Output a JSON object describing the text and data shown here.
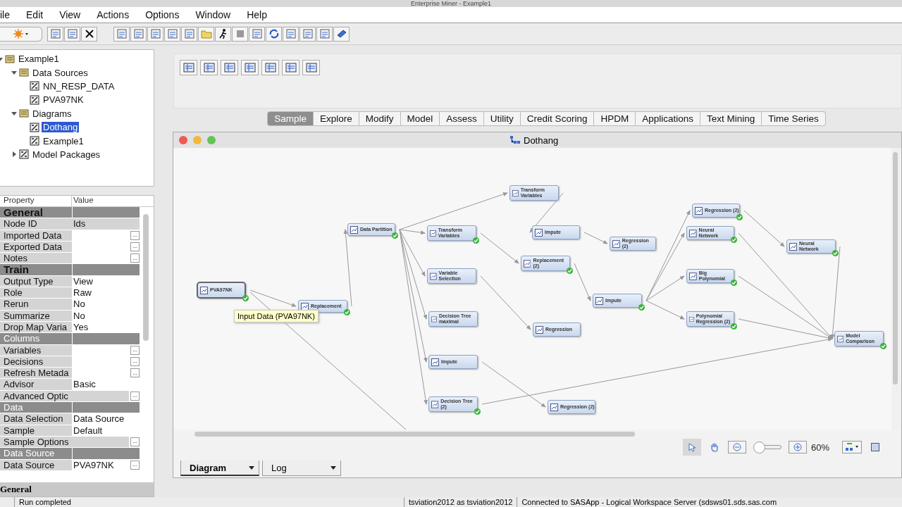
{
  "window": {
    "title": "Enterprise Miner - Example1"
  },
  "menu": [
    "ile",
    "Edit",
    "View",
    "Actions",
    "Options",
    "Window",
    "Help"
  ],
  "tree": [
    {
      "label": "Example1",
      "expanded": true,
      "selected": false,
      "children": [
        {
          "label": "Data Sources",
          "expanded": true,
          "selected": false,
          "children": [
            {
              "label": "NN_RESP_DATA",
              "selected": false
            },
            {
              "label": "PVA97NK",
              "selected": false
            }
          ]
        },
        {
          "label": "Diagrams",
          "expanded": true,
          "selected": false,
          "children": [
            {
              "label": "Dothang",
              "selected": true
            },
            {
              "label": "Example1",
              "selected": false
            }
          ]
        },
        {
          "label": "Model Packages",
          "expanded": false,
          "selected": false
        }
      ]
    }
  ],
  "properties": {
    "columns": [
      "Property",
      "Value"
    ],
    "rows": [
      {
        "kind": "section",
        "label": "General"
      },
      {
        "kind": "property",
        "name": "Node ID",
        "value": "Ids",
        "editable": false
      },
      {
        "kind": "property",
        "name": "Imported Data",
        "editable": true,
        "button": "..."
      },
      {
        "kind": "property",
        "name": "Exported Data",
        "editable": true,
        "button": "..."
      },
      {
        "kind": "property",
        "name": "Notes",
        "editable": true,
        "button": "..."
      },
      {
        "kind": "section",
        "label": "Train"
      },
      {
        "kind": "property",
        "name": "Output Type",
        "value": "View",
        "editable": true
      },
      {
        "kind": "property",
        "name": "Role",
        "value": "Raw",
        "editable": true
      },
      {
        "kind": "property",
        "name": "Rerun",
        "value": "No",
        "editable": true
      },
      {
        "kind": "property",
        "name": "Summarize",
        "value": "No",
        "editable": true
      },
      {
        "kind": "property",
        "name": "Drop Map Varia",
        "value": "Yes",
        "editable": true
      },
      {
        "kind": "group",
        "label": "Columns"
      },
      {
        "kind": "property",
        "name": "Variables",
        "editable": true,
        "button": "..."
      },
      {
        "kind": "property",
        "name": "Decisions",
        "editable": true,
        "button": "..."
      },
      {
        "kind": "property",
        "name": "Refresh Metada",
        "editable": true,
        "button": "..."
      },
      {
        "kind": "property",
        "name": "Advisor",
        "value": "Basic",
        "editable": true
      },
      {
        "kind": "property",
        "name": "Advanced Optic",
        "editable": false,
        "button": "..."
      },
      {
        "kind": "group",
        "label": "Data"
      },
      {
        "kind": "property",
        "name": "Data Selection",
        "value": "Data Source",
        "editable": true
      },
      {
        "kind": "property",
        "name": "Sample",
        "value": "Default",
        "editable": true
      },
      {
        "kind": "property",
        "name": "Sample Options",
        "editable": false,
        "button": "..."
      },
      {
        "kind": "group",
        "label": "Data Source"
      },
      {
        "kind": "property",
        "name": "Data Source",
        "value": "PVA97NK",
        "editable": true,
        "button": "..."
      }
    ],
    "footer": "General"
  },
  "tool_tabs": [
    {
      "label": "Sample",
      "selected": true
    },
    {
      "label": "Explore",
      "selected": false
    },
    {
      "label": "Modify",
      "selected": false
    },
    {
      "label": "Model",
      "selected": false
    },
    {
      "label": "Assess",
      "selected": false
    },
    {
      "label": "Utility",
      "selected": false
    },
    {
      "label": "Credit Scoring",
      "selected": false
    },
    {
      "label": "HPDM",
      "selected": false
    },
    {
      "label": "Applications",
      "selected": false
    },
    {
      "label": "Text Mining",
      "selected": false
    },
    {
      "label": "Time Series",
      "selected": false
    }
  ],
  "diagram": {
    "title": "Dothang",
    "nodes": [
      {
        "label": "PVA97NK",
        "selected": true,
        "completed": true
      },
      {
        "label": "Replacement",
        "selected": false,
        "completed": true
      },
      {
        "label": "Data Partition",
        "selected": false,
        "completed": true
      },
      {
        "label": "Transform Variables",
        "selected": false,
        "completed": true
      },
      {
        "label": "Variable Selection",
        "selected": false,
        "completed": false
      },
      {
        "label": "Decision Tree maximal",
        "selected": false,
        "completed": false
      },
      {
        "label": "Impute",
        "selected": false,
        "completed": false
      },
      {
        "label": "Decision Tree (2)",
        "selected": false,
        "completed": true
      },
      {
        "label": "Transform Variables",
        "selected": false,
        "completed": false
      },
      {
        "label": "Impute",
        "selected": false,
        "completed": false
      },
      {
        "label": "Replacement (2)",
        "selected": false,
        "completed": true
      },
      {
        "label": "Regression",
        "selected": false,
        "completed": false
      },
      {
        "label": "Regression (2)",
        "selected": false,
        "completed": false
      },
      {
        "label": "Regression (2)",
        "selected": false,
        "completed": false
      },
      {
        "label": "Impute",
        "selected": false,
        "completed": true
      },
      {
        "label": "Regression (2)",
        "selected": false,
        "completed": true
      },
      {
        "label": "Neural Network",
        "selected": false,
        "completed": true
      },
      {
        "label": "Big Polynomial",
        "selected": false,
        "completed": true
      },
      {
        "label": "Polynomial Regression (2)",
        "selected": false,
        "completed": true
      },
      {
        "label": "Neural Network",
        "selected": false,
        "completed": true
      },
      {
        "label": "Model Comparison",
        "selected": false,
        "completed": true
      }
    ],
    "tooltip": "Input Data (PVA97NK)",
    "zoom": {
      "reading": "60%"
    },
    "tabs": [
      {
        "label": "Diagram",
        "selected": true
      },
      {
        "label": "Log",
        "selected": false
      }
    ]
  },
  "status_bar": [
    "Run completed",
    "tsviation2012 as tsviation2012",
    "Connected to SASApp - Logical Workspace Server (sdsws01.sds.sas.com"
  ]
}
